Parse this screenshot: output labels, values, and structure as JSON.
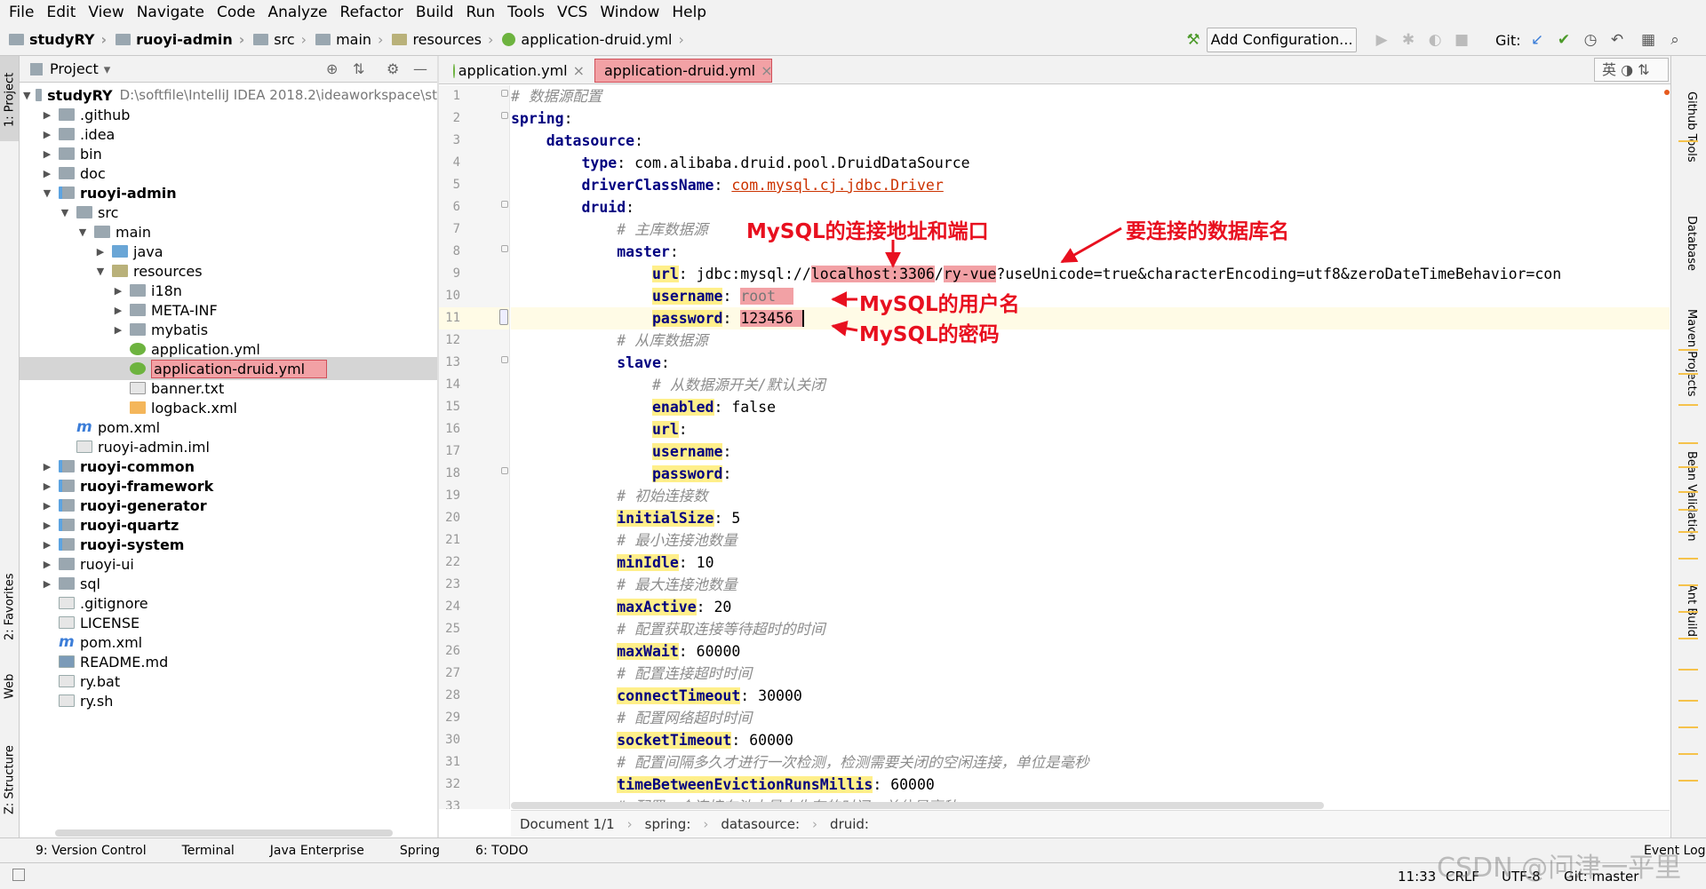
{
  "menu": [
    "File",
    "Edit",
    "View",
    "Navigate",
    "Code",
    "Analyze",
    "Refactor",
    "Build",
    "Run",
    "Tools",
    "VCS",
    "Window",
    "Help"
  ],
  "breadcrumb": [
    "studyRY",
    "ruoyi-admin",
    "src",
    "main",
    "resources",
    "application-druid.yml"
  ],
  "toolbar": {
    "add_config": "Add Configuration...",
    "git_label": "Git:"
  },
  "left_tabs": {
    "project": "1: Project",
    "favorites": "2: Favorites",
    "web": "Web",
    "structure": "Z: Structure"
  },
  "project": {
    "header": "Project",
    "tree": [
      {
        "label": "studyRY",
        "path": "D:\\softfile\\IntelliJ IDEA 2018.2\\ideaworkspace\\st",
        "bold": true
      },
      {
        "label": ".github"
      },
      {
        "label": ".idea"
      },
      {
        "label": "bin"
      },
      {
        "label": "doc"
      },
      {
        "label": "ruoyi-admin",
        "bold": true
      },
      {
        "label": "src"
      },
      {
        "label": "main"
      },
      {
        "label": "java"
      },
      {
        "label": "resources"
      },
      {
        "label": "i18n"
      },
      {
        "label": "META-INF"
      },
      {
        "label": "mybatis"
      },
      {
        "label": "application.yml"
      },
      {
        "label": "application-druid.yml"
      },
      {
        "label": "banner.txt"
      },
      {
        "label": "logback.xml"
      },
      {
        "label": "pom.xml"
      },
      {
        "label": "ruoyi-admin.iml"
      },
      {
        "label": "ruoyi-common",
        "bold": true
      },
      {
        "label": "ruoyi-framework",
        "bold": true
      },
      {
        "label": "ruoyi-generator",
        "bold": true
      },
      {
        "label": "ruoyi-quartz",
        "bold": true
      },
      {
        "label": "ruoyi-system",
        "bold": true
      },
      {
        "label": "ruoyi-ui"
      },
      {
        "label": "sql"
      },
      {
        "label": ".gitignore"
      },
      {
        "label": "LICENSE"
      },
      {
        "label": "pom.xml"
      },
      {
        "label": "README.md"
      },
      {
        "label": "ry.bat"
      },
      {
        "label": "ry.sh"
      }
    ]
  },
  "editor_tabs": [
    "application.yml",
    "application-druid.yml"
  ],
  "ime": {
    "lang": "英"
  },
  "code": {
    "line1": "# 数据源配置",
    "line2_key": "spring",
    "line3_key": "datasource",
    "line4_key": "type",
    "line4_val": "com.alibaba.druid.pool.DruidDataSource",
    "line5_key": "driverClassName",
    "line5_val": "com.mysql.cj.jdbc.Driver",
    "line6_key": "druid",
    "line7": "# 主库数据源",
    "line8_key": "master",
    "line9_key": "url",
    "line9_pre": "jdbc:mysql://",
    "line9_host": "localhost:3306",
    "line9_slash": "/",
    "line9_db": "ry-vue",
    "line9_rest": "?useUnicode=true&characterEncoding=utf8&zeroDateTimeBehavior=con",
    "line10_key": "username",
    "line10_val": "root",
    "line11_key": "password",
    "line11_val": "123456",
    "line12": "# 从库数据源",
    "line13_key": "slave",
    "line14": "# 从数据源开关/默认关闭",
    "line15_key": "enabled",
    "line15_val": "false",
    "line16_key": "url",
    "line17_key": "username",
    "line18_key": "password",
    "line19": "# 初始连接数",
    "line20_key": "initialSize",
    "line20_val": "5",
    "line21": "# 最小连接池数量",
    "line22_key": "minIdle",
    "line22_val": "10",
    "line23": "# 最大连接池数量",
    "line24_key": "maxActive",
    "line24_val": "20",
    "line25": "# 配置获取连接等待超时的时间",
    "line26_key": "maxWait",
    "line26_val": "60000",
    "line27": "# 配置连接超时时间",
    "line28_key": "connectTimeout",
    "line28_val": "30000",
    "line29": "# 配置网络超时时间",
    "line30_key": "socketTimeout",
    "line30_val": "60000",
    "line31": "# 配置间隔多久才进行一次检测，检测需要关闭的空闲连接，单位是毫秒",
    "line32_key": "timeBetweenEvictionRunsMillis",
    "line32_val": "60000",
    "line33": "# 配置一个连接在池中最小生存的时间，单位是毫秒"
  },
  "annotations": {
    "host": "MySQL的连接地址和端口",
    "db": "要连接的数据库名",
    "user": "MySQL的用户名",
    "pwd": "MySQL的密码"
  },
  "editor_breadcrumb": [
    "Document 1/1",
    "spring:",
    "datasource:",
    "druid:"
  ],
  "right_tabs": [
    "Github Tools",
    "Database",
    "Maven Projects",
    "Bean Validation",
    "Ant Build"
  ],
  "bottom_tools": [
    "9: Version Control",
    "Terminal",
    "Java Enterprise",
    "Spring",
    "6: TODO"
  ],
  "event_log": "Event Log",
  "status": {
    "pos": "11:33",
    "eol": "CRLF",
    "enc": "UTF-8",
    "git": "Git: master"
  },
  "watermark": "CSDN @问津一平里",
  "colors": {
    "highlight_red": "#f2a1a5",
    "annotation_red": "#e8101f",
    "key_blue": "#000080",
    "selection": "#d5d5d5"
  }
}
